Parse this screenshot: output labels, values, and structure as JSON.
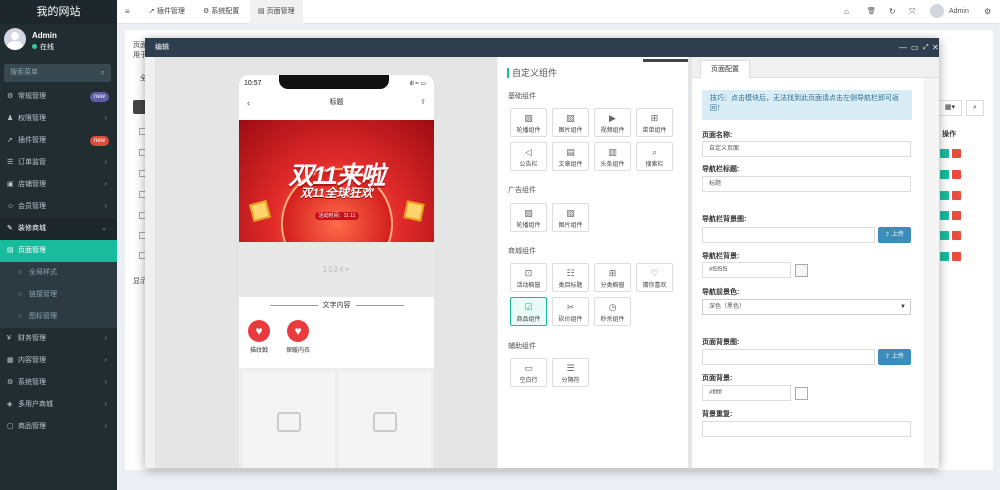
{
  "sidebar": {
    "brand": "我的网站",
    "user": {
      "name": "Admin",
      "status": "在线"
    },
    "search_placeholder": "搜索菜单",
    "items": [
      {
        "label": "常规管理",
        "icon": "gear-icon",
        "glyph": "⚙",
        "badge": "new",
        "badge_color": "#605ca8"
      },
      {
        "label": "权限管理",
        "icon": "group-icon",
        "glyph": "♟",
        "arrow": "‹"
      },
      {
        "label": "插件管理",
        "icon": "rocket-icon",
        "glyph": "➚",
        "badge": "new",
        "badge_color": "#dd4b39"
      },
      {
        "label": "订单监管",
        "icon": "list-icon",
        "glyph": "☰",
        "arrow": "‹"
      },
      {
        "label": "店铺管理",
        "icon": "store-icon",
        "glyph": "▣",
        "arrow": "‹"
      },
      {
        "label": "会员管理",
        "icon": "user-icon",
        "glyph": "☺",
        "arrow": "‹"
      },
      {
        "label": "装修商城",
        "icon": "brush-icon",
        "glyph": "✎",
        "arrow": "⌄"
      },
      {
        "label": "页面管理",
        "icon": "page-icon",
        "glyph": "▤"
      },
      {
        "label": "全局样式",
        "icon": "circle-icon",
        "glyph": "○"
      },
      {
        "label": "链接管理",
        "icon": "circle-icon",
        "glyph": "○"
      },
      {
        "label": "图标管理",
        "icon": "circle-icon",
        "glyph": "○"
      },
      {
        "label": "财务管理",
        "icon": "money-icon",
        "glyph": "¥",
        "arrow": "‹"
      },
      {
        "label": "内容管理",
        "icon": "doc-icon",
        "glyph": "▦",
        "arrow": "‹"
      },
      {
        "label": "系统管理",
        "icon": "cog-icon",
        "glyph": "⚙",
        "arrow": "‹"
      },
      {
        "label": "多用户商城",
        "icon": "bag-icon",
        "glyph": "◈",
        "arrow": "‹"
      },
      {
        "label": "商品管理",
        "icon": "box-icon",
        "glyph": "▢",
        "arrow": "‹"
      }
    ]
  },
  "topbar": {
    "menu_icon": "≡",
    "tabs": [
      {
        "label": "插件管理",
        "glyph": "➚"
      },
      {
        "label": "系统配置",
        "glyph": "⚙"
      },
      {
        "label": "页面管理",
        "glyph": "▤"
      }
    ],
    "right_icons": [
      "⌂",
      "🗑",
      "↻",
      "⤧"
    ],
    "admin": "Admin",
    "settings_icon": "⚙"
  },
  "background": {
    "title": "页面",
    "subtitle": "用于",
    "footer": "显示",
    "col_header": "操作",
    "tab_initial": "全"
  },
  "modal": {
    "title": "编辑",
    "controls": [
      "—",
      "▭",
      "⤢",
      "✕"
    ]
  },
  "phone": {
    "time": "10:57",
    "signal": "ıll ≈ ▭",
    "nav_title": "标题",
    "back": "‹",
    "share": "⇪",
    "banner": {
      "t1": "双11来啦",
      "t2": "双11全球狂欢",
      "t3": "活动时间：11.11"
    },
    "placeholder": "1024×",
    "text_section": "文字内容",
    "hearts": [
      {
        "label": "描纹戟"
      },
      {
        "label": "保暖内衣"
      }
    ]
  },
  "palette": {
    "title": "自定义组件",
    "groups": [
      {
        "title": "基础组件",
        "items": [
          {
            "label": "轮播组件",
            "icon": "image-icon",
            "glyph": "▨"
          },
          {
            "label": "图片组件",
            "icon": "picture-icon",
            "glyph": "▧"
          },
          {
            "label": "视频组件",
            "icon": "video-icon",
            "glyph": "▶"
          },
          {
            "label": "菜单组件",
            "icon": "grid-icon",
            "glyph": "⊞"
          },
          {
            "label": "公告栏",
            "icon": "megaphone-icon",
            "glyph": "◁"
          },
          {
            "label": "文章组件",
            "icon": "article-icon",
            "glyph": "▤"
          },
          {
            "label": "头条组件",
            "icon": "headline-icon",
            "glyph": "▥"
          },
          {
            "label": "搜索栏",
            "icon": "search-icon",
            "glyph": "⌕"
          }
        ]
      },
      {
        "title": "广告组件",
        "items": [
          {
            "label": "轮播组件",
            "icon": "image-icon",
            "glyph": "▨"
          },
          {
            "label": "图片组件",
            "icon": "picture-icon",
            "glyph": "▧"
          }
        ]
      },
      {
        "title": "商城组件",
        "items": [
          {
            "label": "活动橱窗",
            "icon": "gift-icon",
            "glyph": "⊡"
          },
          {
            "label": "类目标题",
            "icon": "category-icon",
            "glyph": "☷"
          },
          {
            "label": "分类橱窗",
            "icon": "category-grid-icon",
            "glyph": "⊞"
          },
          {
            "label": "猜你喜欢",
            "icon": "heart-icon",
            "glyph": "♡"
          },
          {
            "label": "商品组件",
            "icon": "product-icon",
            "glyph": "☑"
          },
          {
            "label": "砍价组件",
            "icon": "bargain-icon",
            "glyph": "✂"
          },
          {
            "label": "秒杀组件",
            "icon": "clock-icon",
            "glyph": "◷"
          }
        ]
      },
      {
        "title": "辅助组件",
        "items": [
          {
            "label": "空白行",
            "icon": "blank-icon",
            "glyph": "▭"
          },
          {
            "label": "分隔符",
            "icon": "separator-icon",
            "glyph": "☰"
          }
        ]
      }
    ]
  },
  "config": {
    "tab": "页面配置",
    "tip": "技巧：点击模块后，无法找到此页面请点击左侧导航栏即可返回！",
    "fields": {
      "page_name": {
        "label": "页面名称:",
        "value": "自定义页面"
      },
      "nav_title": {
        "label": "导航栏标题:",
        "value": "标题"
      },
      "nav_bg_image": {
        "label": "导航栏背景图:",
        "value": ""
      },
      "nav_bg": {
        "label": "导航栏背景:",
        "value": "#f5f5f5"
      },
      "nav_fg": {
        "label": "导航前景色:",
        "value": "深色（黑色）"
      },
      "page_bg_image": {
        "label": "页面背景图:",
        "value": ""
      },
      "page_bg": {
        "label": "页面背景:",
        "value": "#ffffff"
      },
      "bg_repeat": {
        "label": "背景重复:",
        "value": ""
      }
    },
    "upload_label": "上传"
  },
  "colors": {
    "accent": "#18bc9c",
    "sidebar": "#222d32",
    "modal_header": "#2e3e4e",
    "upload": "#3c8dbc"
  }
}
